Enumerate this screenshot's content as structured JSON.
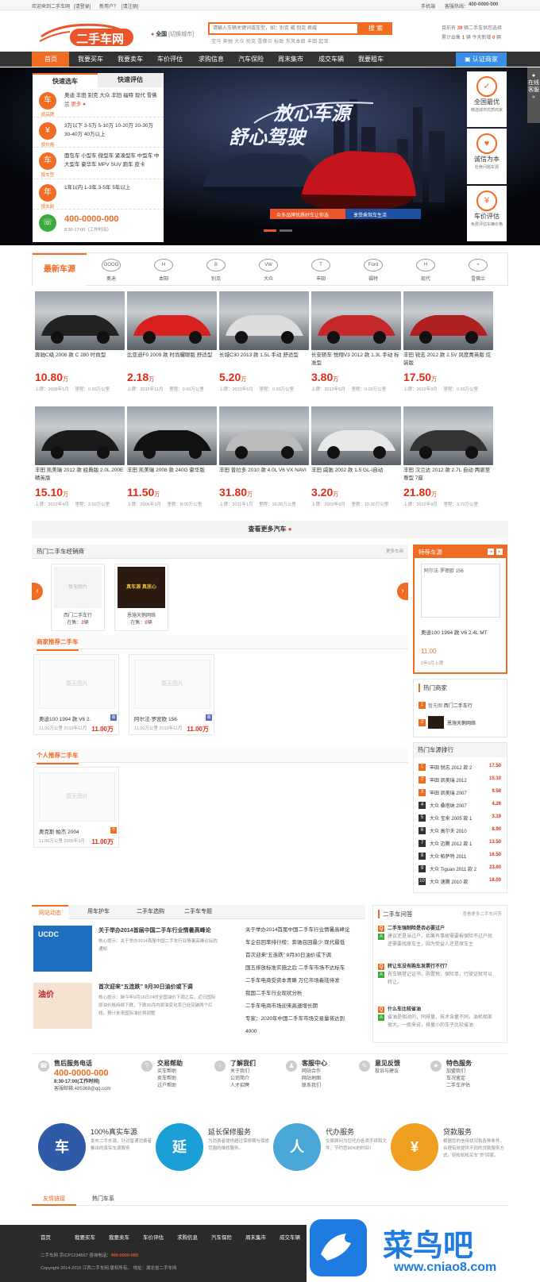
{
  "topbar": {
    "welcome": "欢迎来到二手车网",
    "login": "[请登录]",
    "newuser": "新用户？",
    "register": "[请注册]",
    "mobile": "手机端",
    "hotline_label": "客服热线：",
    "hotline": "400-0000-000"
  },
  "header": {
    "logo_text": "二手车网",
    "city": "全国",
    "city_switch": "[切换城市]",
    "search_placeholder": "请输入车辆关键词或车型，如：别克 威 别克 君威",
    "search_button": "搜 索",
    "hot_words": "宝马 奔驰 大众 别克 雪佛兰 标致 东风本田 丰田 起亚",
    "stat1_a": "目前有",
    "stat1_num": "39",
    "stat1_b": "辆二手车供您选择",
    "stat2_a": "累计出售",
    "stat2_num": "1",
    "stat2_b": "辆 今天新增",
    "stat2_num2": "0",
    "stat2_c": "辆"
  },
  "nav": {
    "items": [
      "首页",
      "我要买车",
      "我要卖车",
      "车价评估",
      "求购信息",
      "汽车保险",
      "周末集市",
      "成交车辆",
      "我要租车"
    ],
    "cert": "认证商家"
  },
  "banner": {
    "title1": "放心车源",
    "title2": "舒心驾驶",
    "tag1": "众多品牌优质好车让你选",
    "tag2": "享受乘驾车生活"
  },
  "quick": {
    "tab1": "快速选车",
    "tab2": "快速评估",
    "rows": [
      {
        "icon": "车",
        "label": "按品牌",
        "text": "奥迪 丰田 别克 大众 丰田 福特 现代 雪佛兰",
        "more": "更多"
      },
      {
        "icon": "¥",
        "label": "按价格",
        "text": "3万以下 3-5万 5-10万 10-20万 20-30万 30-40万 40万以上"
      },
      {
        "icon": "车",
        "label": "按车型",
        "text": "面包车 小型车 微型车 紧凑型车 中型车 中大型车 豪华车 MPV SUV 跑车 皮卡"
      },
      {
        "icon": "年",
        "label": "按车龄",
        "text": "1年以内 1-3年 3-5年 5年以上"
      }
    ],
    "phone": "400-0000-000",
    "phone_hours": "8:30-17:00（工作时间）"
  },
  "rside": [
    {
      "title": "全国最优",
      "sub": "精选城市优质商家"
    },
    {
      "title": "诚信为本",
      "sub": "杜绝问题车源"
    },
    {
      "title": "车价评估",
      "sub": "免费评估车辆价格"
    }
  ],
  "kefu": "在线客服",
  "brands": {
    "first": "最新车源",
    "items": [
      {
        "logo": "OOOO",
        "name": "奥迪"
      },
      {
        "logo": "H",
        "name": "本田"
      },
      {
        "logo": "B",
        "name": "别克"
      },
      {
        "logo": "VW",
        "name": "大众"
      },
      {
        "logo": "T",
        "name": "丰田"
      },
      {
        "logo": "Ford",
        "name": "福特"
      },
      {
        "logo": "H",
        "name": "现代"
      },
      {
        "logo": "+",
        "name": "雪佛兰"
      }
    ]
  },
  "cars": [
    {
      "name": "奔驰C级 2008 款 C 280 时尚型",
      "price": "10.80",
      "unit": "万",
      "date": "上牌：2008年5月",
      "km": "里程：0.00万公里",
      "color": "#222"
    },
    {
      "name": "比亚迪F0 2009 款 时尚耀眼版 舒适型",
      "price": "2.18",
      "unit": "万",
      "date": "上牌：2015年11月",
      "km": "里程：0.00万公里",
      "color": "#d82020"
    },
    {
      "name": "长城C30 2013 款 1.5L 手动 舒适型",
      "price": "5.20",
      "unit": "万",
      "date": "上牌：2013年6月",
      "km": "里程：0.00万公里",
      "color": "#ddd"
    },
    {
      "name": "长安轿车 悦翔V3 2012 款 1.3L 手动 标准型",
      "price": "3.80",
      "unit": "万",
      "date": "上牌：2013年5月",
      "km": "里程：0.00万公里",
      "color": "#c42828"
    },
    {
      "name": "丰田 锐志 2012 款 2.5V 风度菁英版 炫装版",
      "price": "17.50",
      "unit": "万",
      "date": "上牌：2012年9月",
      "km": "里程：0.00万公里",
      "color": "#b02020"
    },
    {
      "name": "丰田 凯美瑞 2012 款 经典版 2.0L 200E 精英版",
      "price": "15.10",
      "unit": "万",
      "date": "上牌：2012年4月",
      "km": "里程：3.50万公里",
      "color": "#1a1a1a"
    },
    {
      "name": "丰田 凯美瑞 2008 款 240G 豪华版",
      "price": "11.50",
      "unit": "万",
      "date": "上牌：2006年3月",
      "km": "里程：8.00万公里",
      "color": "#111"
    },
    {
      "name": "丰田 普拉多 2010 款 4.0L V6 VX NAVI",
      "price": "31.80",
      "unit": "万",
      "date": "上牌：2011年1月",
      "km": "里程：16.00万公里",
      "color": "#bbb"
    },
    {
      "name": "丰田 威驰 2002 款 1.5 GL-i自动",
      "price": "3.20",
      "unit": "万",
      "date": "上牌：2003年9月",
      "km": "里程：10.00万公里",
      "color": "#e8e8e8"
    },
    {
      "name": "丰田 汉兰达 2012 款 2.7L 自动 两驱至尊型 7座",
      "price": "21.80",
      "unit": "万",
      "date": "上牌：2012年9月",
      "km": "里程：3.70万公里",
      "color": "#333"
    }
  ],
  "more_cars": "查看更多汽车",
  "dealers": {
    "title": "热门二手车经销商",
    "more": "更多车商",
    "items": [
      {
        "photo": "暂无图片",
        "name": "西门二手车行",
        "count_a": "在售：",
        "count": "2",
        "count_b": "辆"
      },
      {
        "photo": "真车源 真放心",
        "name": "恩施天鹅网络",
        "count_a": "在售：",
        "count": "0",
        "count_b": "辆"
      }
    ]
  },
  "special": {
    "title": "特荐车源",
    "photo": "阿尔法·罗密欧 156",
    "name": "奥迪100 1994 款 V6 2.4L MT",
    "price": "11.00",
    "date": "0年0月上牌"
  },
  "merchant_rec": {
    "title": "商家推荐二手车",
    "items": [
      {
        "photo": "暂无图片",
        "name": "奥迪100 1994 款 V6 2.",
        "date": "11.00万公里 2013年11月",
        "price": "11.00万",
        "badge": "商"
      },
      {
        "photo": "暂无图片",
        "name": "阿尔法·罗密欧 156",
        "date": "11.00万公里 2013年11月",
        "price": "11.00万",
        "badge": "商"
      }
    ]
  },
  "personal_rec": {
    "title": "个人推荐二手车",
    "items": [
      {
        "photo": "暂无图片",
        "name": "奥克斯 帕杰 2004",
        "date": "11.00万公里 2005年3月",
        "price": "11.00万",
        "badge": "个"
      }
    ]
  },
  "hot_merchants": {
    "title": "热门商家",
    "items": [
      {
        "name": "暂无图",
        "sub": "西门二手车行"
      },
      {
        "name": "",
        "sub": "恩施天鹅网络"
      }
    ]
  },
  "rank": {
    "title": "热门车源排行",
    "items": [
      {
        "n": "1",
        "name": "丰田 锐志 2012 款 2",
        "price": "17.50"
      },
      {
        "n": "2",
        "name": "丰田 凯美瑞 2012",
        "price": "15.10"
      },
      {
        "n": "3",
        "name": "丰田 凯美瑞 2007",
        "price": "9.58"
      },
      {
        "n": "4",
        "name": "大众 桑塔纳 2007",
        "price": "4.26"
      },
      {
        "n": "5",
        "name": "大众 宝来 2005 款 1",
        "price": "3.19"
      },
      {
        "n": "6",
        "name": "大众 高尔夫 2010",
        "price": "8.90"
      },
      {
        "n": "7",
        "name": "大众 迈腾 2012 款 1",
        "price": "13.50"
      },
      {
        "n": "8",
        "name": "大众 帕萨特 2011",
        "price": "16.50"
      },
      {
        "n": "9",
        "name": "大众 Tiguan 2011 款 2",
        "price": "23.60"
      },
      {
        "n": "10",
        "name": "大众 速腾 2010 款",
        "price": "18.00"
      }
    ]
  },
  "news": {
    "tabs": [
      "网站动态",
      "用车护车",
      "二手车选购",
      "二手车专题"
    ],
    "feature1": {
      "title": "关于举办2014首届中国二手车行业情暑高峰论",
      "desc": "核心提示：关于举办2014首届中国二手车行业情暑高峰论坛的通知",
      "thumb": "UCDC"
    },
    "feature2": {
      "title": "首次迎来“五连跌”  9月30日油价或下调",
      "desc": "核心提示：继今年9月16日24时全国油价下调之后，近日国际原油价格持续下跌，下跌30月内原油变化率已经突破两个红线，预计未来国际油价将调整",
      "thumb": "油价"
    },
    "list": [
      "关于举办2014首届中国二手车行业情暑高峰论",
      "车企召回率排行榜：奔驰召回最少 现代最低",
      "首次迎来“五连跌”  9月30日油价或下调",
      "国五排放标准实施之后 二手车市场不达标车",
      "二手车电商受资本青睐 万亿市场着陆待发",
      "我国二手车行业现状分析",
      "二手车电商市场迎来高速增长期",
      "专家：2020年中国二手车市场交易量将达到",
      "4000"
    ]
  },
  "qa": {
    "title": "二手车问答",
    "more": "查看更多二手车问答",
    "items": [
      {
        "q": "二手车强制险是否必要过户",
        "a": "建议还是当过户，如果有事故需要报保险不过户就还需要找原车主，因为受益人还是原车主"
      },
      {
        "q": "转让车没有购车发票行不行？",
        "a": "有车辆登记证书，购置税，保险单，行驶证就可以转让。"
      },
      {
        "q": "什么车比较省油",
        "a": "省油是相对的，同排量，技术含量不同，油耗相差很大。一般来说，排量小的车子比较省油"
      }
    ]
  },
  "services": [
    {
      "icon": "☎",
      "title": "售后服务电话",
      "phone": "400-0000-000",
      "hours": "8:30-17:00(工作时间)",
      "mail": "客服邮箱:485368@qq.com",
      "links": []
    },
    {
      "icon": "?",
      "title": "交易帮助",
      "links": [
        "买车帮助",
        "卖车帮助",
        "过户帮助"
      ]
    },
    {
      "icon": "i",
      "title": "了解我们",
      "links": [
        "关于我们",
        "公司简介",
        "人才招聘"
      ]
    },
    {
      "icon": "♟",
      "title": "客服中心",
      "links": [
        "网站合作",
        "网站地图",
        "联系我们"
      ]
    },
    {
      "icon": "✎",
      "title": "意见反馈",
      "links": [
        "投诉与建议"
      ]
    },
    {
      "icon": "★",
      "title": "特色服务",
      "links": [
        "加盟我们",
        "车况鉴定",
        "二手车评估"
      ]
    }
  ],
  "features": [
    {
      "icon": "车",
      "title": "100%真实车源",
      "desc": "发布二手车源，针对普通消费者推出的真实车源服务",
      "color": "#2f5aa8"
    },
    {
      "icon": "延",
      "title": "延长保修服务",
      "desc": "为消费者提供超过保修期与保修范围的维修服务。",
      "color": "#1a9fd6"
    },
    {
      "icon": "人",
      "title": "代办服务",
      "desc": "交易顾问为您代办各类手续和文件，节约您90%的时间！",
      "color": "#4aa8d8"
    },
    {
      "icon": "¥",
      "title": "贷款服务",
      "desc": "根据您的信用状况和各种条件，合理有效提供不同的贷款服务方式，轻松松松买车“贷”回家。",
      "color": "#f0a020"
    }
  ],
  "links_tabs": [
    "友情链接",
    "热门车系"
  ],
  "footer": {
    "links": [
      "首页",
      "我要买车",
      "我要卖车",
      "车价评估",
      "求购信息",
      "汽车保险",
      "周末集市",
      "成交车辆"
    ],
    "line1": "二手车网  京ICP1234567  咨询电话：",
    "phone": "400-0000-000",
    "line2": "Copyright 2014-2015 江西二手车网 版权所有。  地址：湖北省二手车网"
  },
  "watermark": {
    "cn": "菜鸟吧",
    "url": "www.cniao8.com"
  }
}
